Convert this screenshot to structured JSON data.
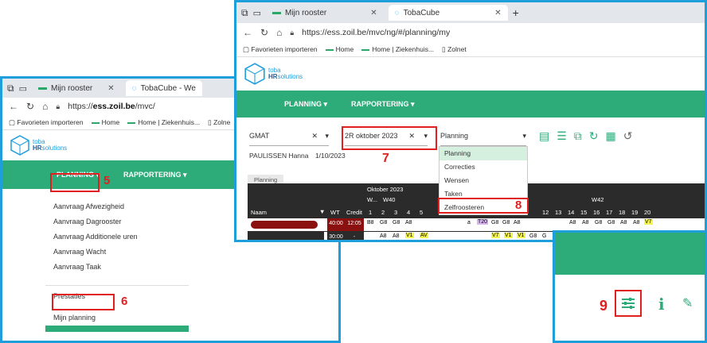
{
  "left": {
    "tab1": "Mijn rooster",
    "tab2": "TobaCube - We",
    "url_prefix": "https://",
    "url_bold": "ess.zoil.be",
    "url_rest": "/mvc/",
    "favorites": [
      "Favorieten importeren",
      "Home",
      "Home | Ziekenhuis...",
      "Zolne"
    ],
    "logo_toba": "toba",
    "logo_hr": "HR",
    "logo_sol": "solutions",
    "nav_planning": "PLANNING ▾",
    "nav_rapportering": "RAPPORTERING ▾",
    "menu_items": [
      "Aanvraag Afwezigheid",
      "Aanvraag Dagrooster",
      "Aanvraag Additionele uren",
      "Aanvraag Wacht",
      "Aanvraag Taak"
    ],
    "menu_prestaties": "Prestaties",
    "menu_mijn_planning": "Mijn planning",
    "step5": "5",
    "step6": "6"
  },
  "right": {
    "tab1": "Mijn rooster",
    "tab2": "TobaCube",
    "url": "https://ess.zoil.be/mvc/ng/#/planning/my",
    "favorites": [
      "Favorieten importeren",
      "Home",
      "Home | Ziekenhuis...",
      "Zolnet"
    ],
    "logo_toba": "toba",
    "logo_hr": "HR",
    "logo_sol": "solutions",
    "nav_planning": "PLANNING ▾",
    "nav_rapportering": "RAPPORTERING ▾",
    "gmat": "GMAT",
    "date": "2R oktober 2023",
    "view": "Planning",
    "person": "PAULISSEN Hanna",
    "person_date": "1/10/2023",
    "planning_tab": "Planning",
    "dropdown": [
      "Planning",
      "Correcties",
      "Wensen",
      "Taken",
      "Zelfroosteren"
    ],
    "step7": "7",
    "step8": "8",
    "hdr_month": "Oktober 2023",
    "hdr_w": "W...",
    "hdr_w40": "W40",
    "hdr_w42": "W42",
    "col_naam": "Naam",
    "col_wt": "WT",
    "col_credit": "Credit",
    "days_a": [
      "1",
      "2",
      "3",
      "4",
      "5"
    ],
    "days_b": [
      "12",
      "13",
      "14",
      "15",
      "16",
      "17",
      "18",
      "19",
      "20"
    ],
    "row1_wt": "40:00",
    "row1_credit": "12:05",
    "row1_a": [
      "B8",
      "G8",
      "G8",
      "A8",
      "A8"
    ],
    "row1_mid": [
      "a",
      "T20",
      "G8",
      "G8",
      "A8"
    ],
    "row1_b": [
      "",
      "",
      "A8",
      "A8",
      "G8",
      "G8",
      "A8",
      "A8",
      "V7"
    ],
    "row2_wt": "30:00",
    "row2_credit": "-",
    "row2_a": [
      "",
      "A8",
      "A8",
      "V1",
      "AV"
    ],
    "row2_mid": [
      "",
      "",
      "V7",
      "V1",
      "V1"
    ],
    "row2_b": [
      "G8",
      "G"
    ]
  },
  "zoom": {
    "step9": "9"
  }
}
